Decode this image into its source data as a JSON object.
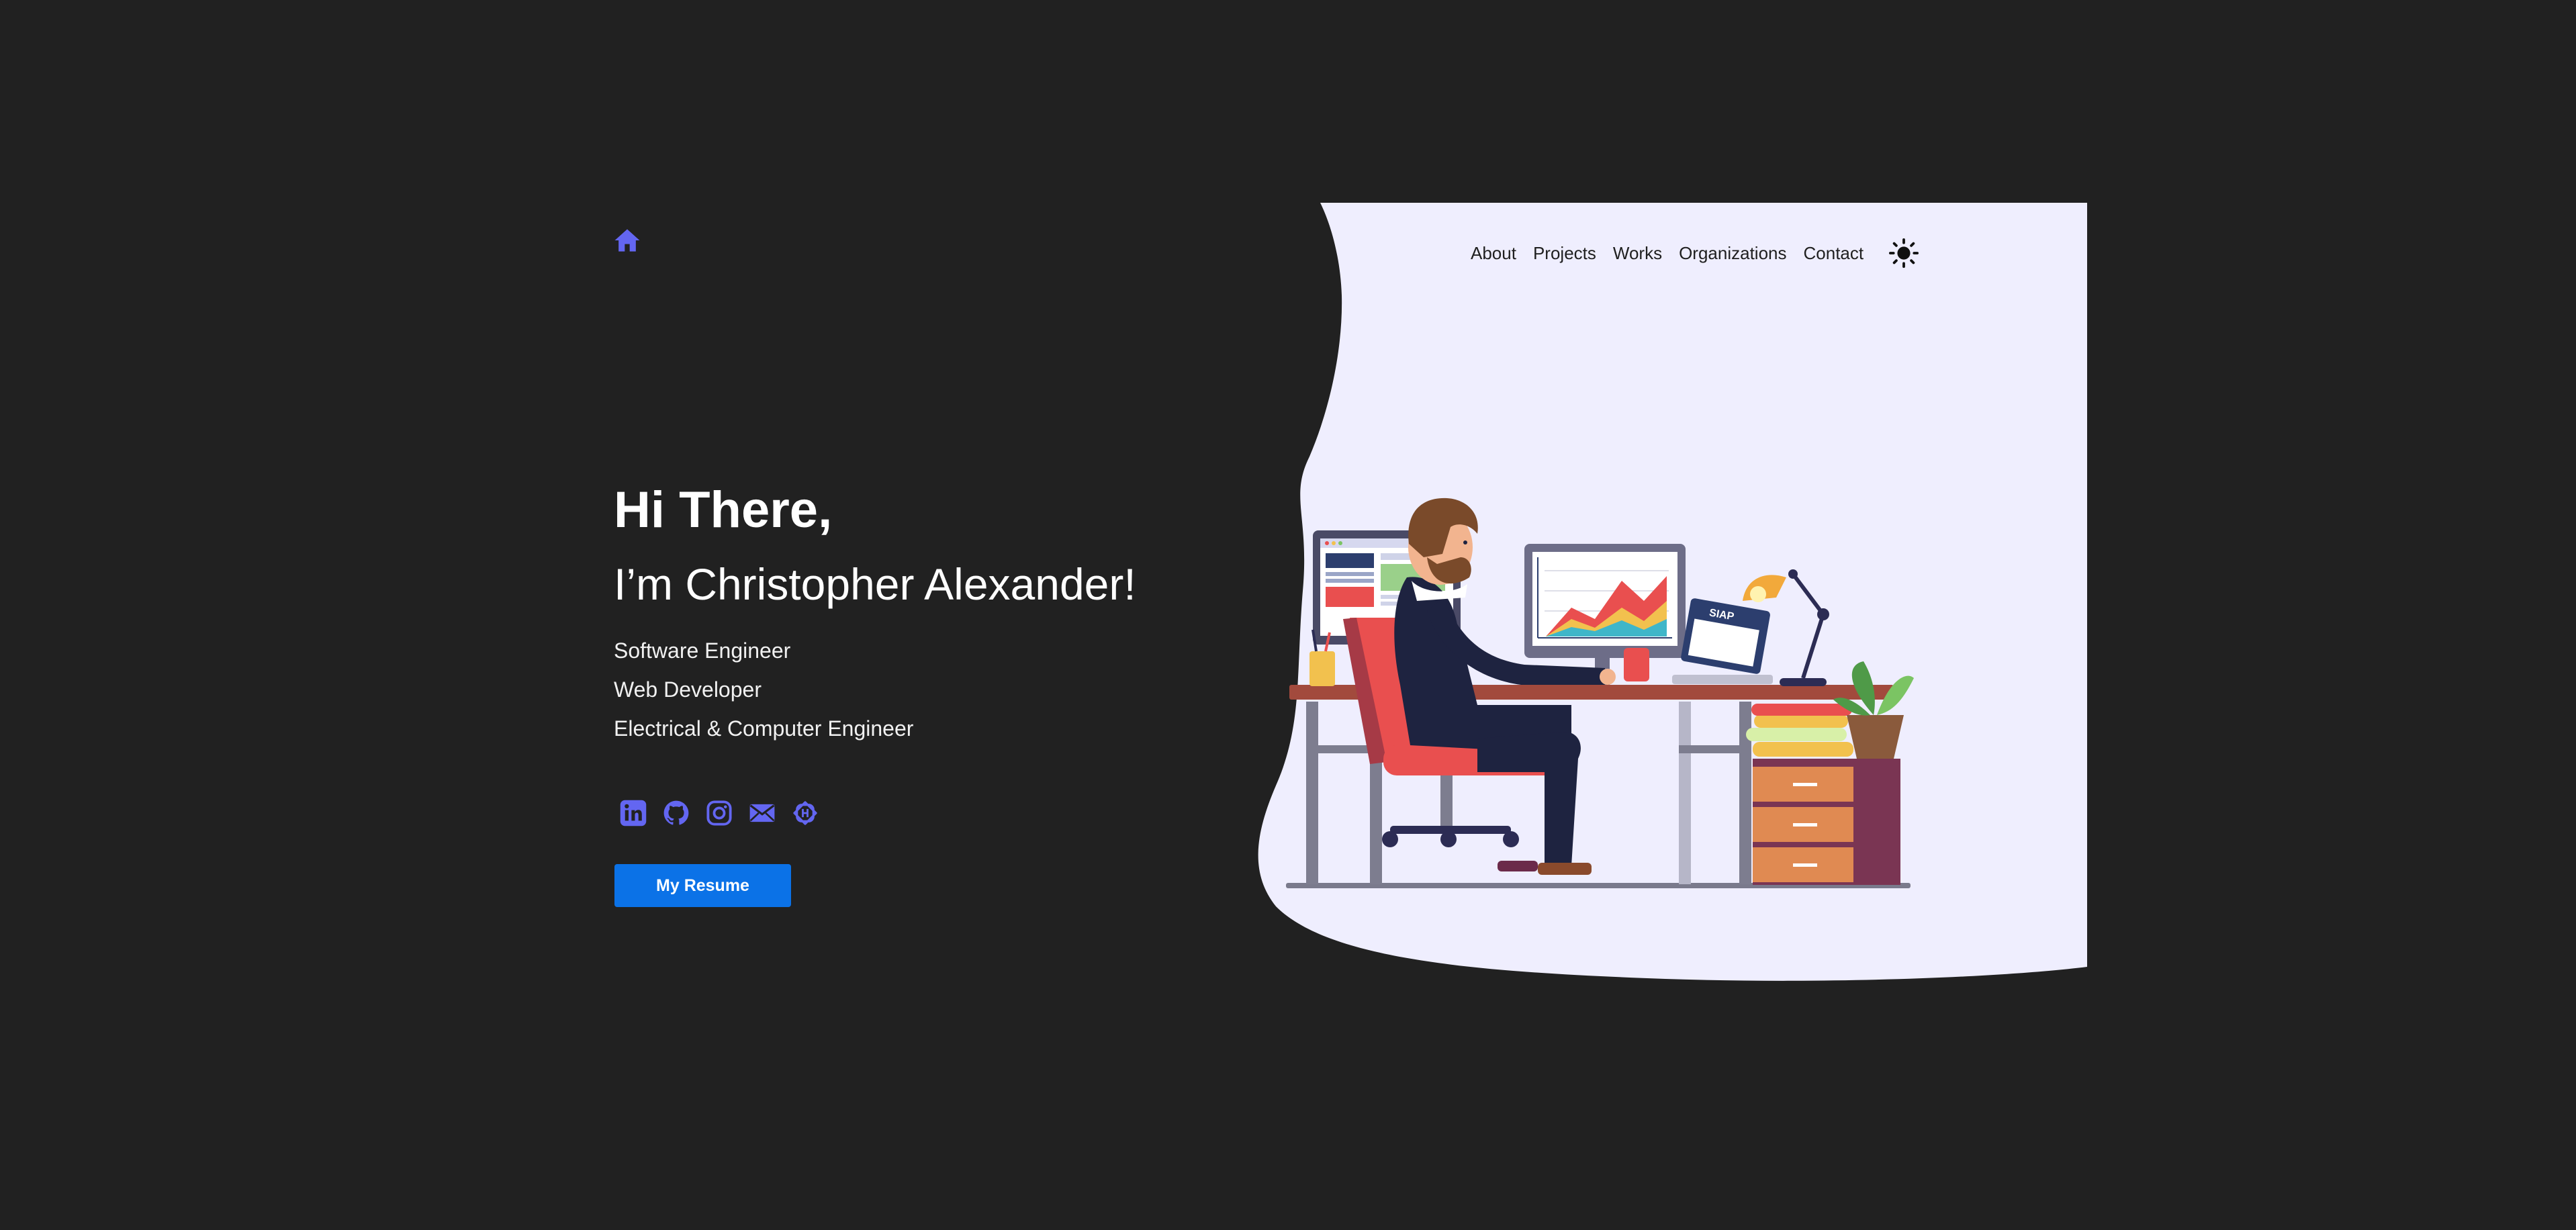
{
  "header": {
    "home_icon": "home-icon",
    "nav": [
      {
        "label": "About"
      },
      {
        "label": "Projects"
      },
      {
        "label": "Works"
      },
      {
        "label": "Organizations"
      },
      {
        "label": "Contact"
      }
    ],
    "theme_icon": "sun-icon"
  },
  "hero": {
    "greeting": "Hi There,",
    "name": "I’m Christopher Alexander!",
    "roles": [
      "Software Engineer",
      "Web Developer",
      "Electrical & Computer Engineer"
    ],
    "social": [
      "linkedin-icon",
      "github-icon",
      "instagram-icon",
      "mail-icon",
      "hashnode-icon"
    ],
    "resume_label": "My Resume"
  },
  "illustration": {
    "laptop_screen_text": "SIAP"
  },
  "colors": {
    "background": "#212121",
    "panel": "#efeefe",
    "accent": "#6366f1",
    "button": "#0b72e7"
  }
}
